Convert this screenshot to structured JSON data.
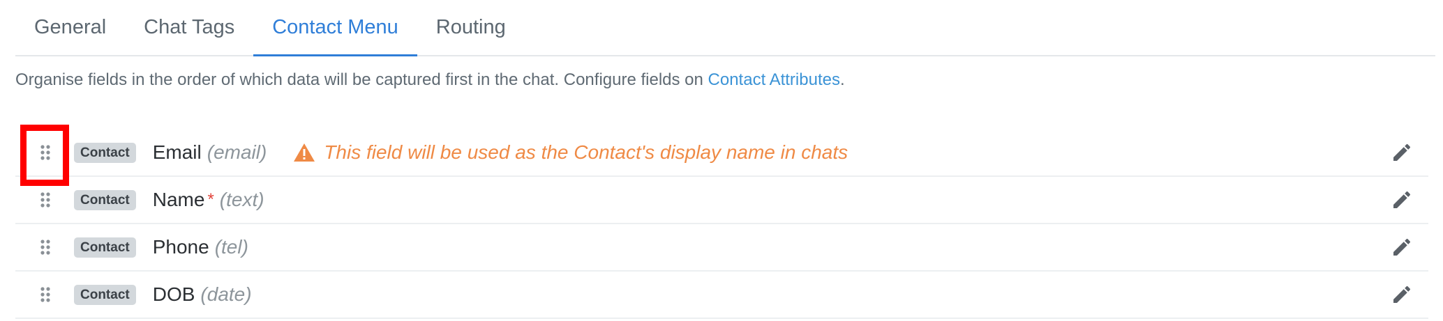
{
  "tabs": [
    {
      "label": "General",
      "active": false
    },
    {
      "label": "Chat Tags",
      "active": false
    },
    {
      "label": "Contact Menu",
      "active": true
    },
    {
      "label": "Routing",
      "active": false
    }
  ],
  "description": {
    "text": "Organise fields in the order of which data will be captured first in the chat. Configure fields on ",
    "link": "Contact Attributes",
    "suffix": "."
  },
  "fields": [
    {
      "badge": "Contact",
      "name": "Email",
      "type": "(email)",
      "required": false,
      "warning": "This field will be used as the Contact's display name in chats"
    },
    {
      "badge": "Contact",
      "name": "Name",
      "type": "(text)",
      "required": true
    },
    {
      "badge": "Contact",
      "name": "Phone",
      "type": "(tel)",
      "required": false
    },
    {
      "badge": "Contact",
      "name": "DOB",
      "type": "(date)",
      "required": false
    }
  ],
  "required_marker": "*",
  "colors": {
    "accent": "#2f7ed8",
    "link": "#3b93d6",
    "warning": "#ef8a45",
    "required": "#e2433a",
    "highlight": "#ff0000"
  },
  "icons": {
    "drag": "drag-handle-icon",
    "warning": "warning-triangle-icon",
    "edit": "pencil-icon"
  }
}
